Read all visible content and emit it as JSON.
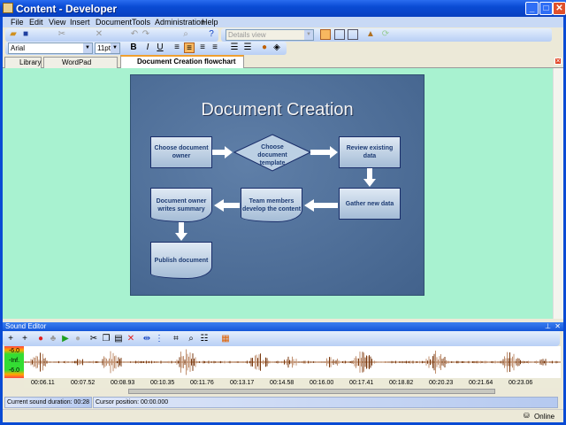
{
  "window": {
    "title": "Content - Developer"
  },
  "menu": [
    "File",
    "Edit",
    "View",
    "Insert",
    "Document",
    "Tools",
    "Administration",
    "Help"
  ],
  "toolbar": {
    "view_select": "Details view",
    "font": "Arial",
    "size": "11pt",
    "bold": "B",
    "italic": "I",
    "underline": "U"
  },
  "tabs": [
    {
      "label": "Library"
    },
    {
      "label": "WordPad Training"
    },
    {
      "label": "Document Creation flowchart"
    }
  ],
  "slide": {
    "title": "Document Creation",
    "nodes": [
      "Choose document owner",
      "Choose document template",
      "Review existing data",
      "Gather new data",
      "Team members develop the content",
      "Document owner writes summary",
      "Publish document"
    ]
  },
  "sound_editor": {
    "title": "Sound Editor",
    "meter": [
      "-6.0",
      "-Inf.",
      "-6.0"
    ],
    "times": [
      "00:06.11",
      "00:07.52",
      "00:08.93",
      "00:10.35",
      "00:11.76",
      "00:13.17",
      "00:14.58",
      "00:16.00",
      "00:17.41",
      "00:18.82",
      "00:20.23",
      "00:21.64",
      "00:23.06"
    ],
    "duration": "Current sound duration: 00:28",
    "cursor": "Cursor position: 00:00.000"
  },
  "statusbar": {
    "online": "Online"
  }
}
